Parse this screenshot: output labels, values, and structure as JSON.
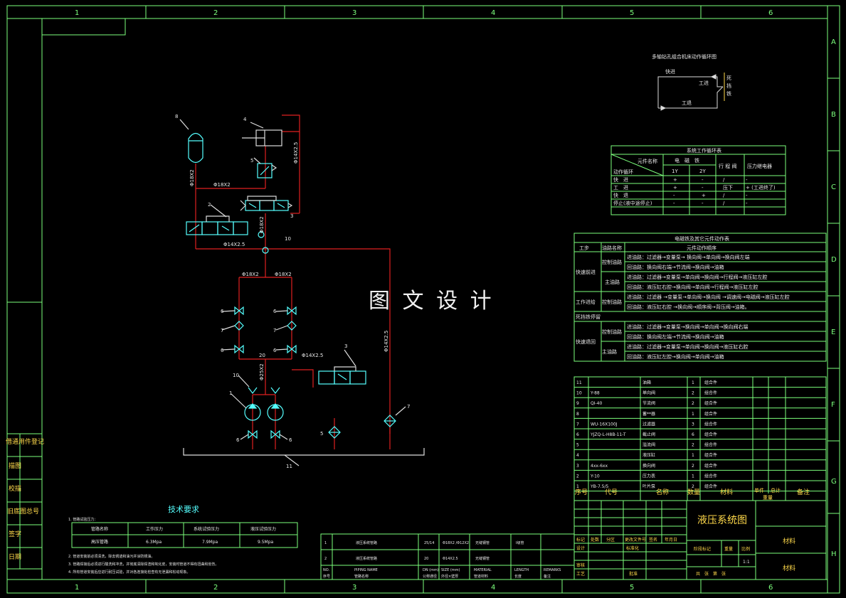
{
  "frame": {
    "top_cols": [
      "1",
      "2",
      "3",
      "4",
      "5",
      "6"
    ],
    "side_rows": [
      "A",
      "B",
      "C",
      "D",
      "E",
      "F",
      "G",
      "H"
    ],
    "left_labels": [
      "借通用件登记",
      "描图",
      "校描",
      "旧底图总号",
      "签字",
      "日期"
    ]
  },
  "watermark": "图 文 设 计",
  "cycle_diagram": {
    "title": "多轴钻孔组合机床动作循环图",
    "fast": "快进",
    "work": "工进",
    "stop": "死挡铁",
    "back": "工退"
  },
  "cycle_table": {
    "title": "系统工作循环表",
    "corner_top": "元件名称",
    "corner_bottom": "动作循环",
    "col_em": "电　磁　铁",
    "col_1y": "1Y",
    "col_2y": "2Y",
    "col_valve": "行 程 阀",
    "col_relay": "压力继电器",
    "rows": [
      {
        "act": "快　进",
        "y1": "+",
        "y2": "-",
        "valve": "/",
        "relay": "-"
      },
      {
        "act": "工　进",
        "y1": "+",
        "y2": "-",
        "valve": "压下",
        "relay": "+ (工进终了)"
      },
      {
        "act": "快　退",
        "y1": "-",
        "y2": "+",
        "valve": "/",
        "relay": "-"
      },
      {
        "act": "停止(液中途停止)",
        "y1": "-",
        "y2": "-",
        "valve": "/",
        "relay": "-"
      }
    ]
  },
  "action_table": {
    "title": "电磁铁及其它元件动作表",
    "h_step": "工步",
    "h_circuit": "油路名称",
    "h_action": "元件动作顺序",
    "g1": "快速前进",
    "g2": "工作进给",
    "g3": "死挡铁停留",
    "g4": "快速退回",
    "ctl": "控制油路",
    "main": "主油路",
    "l1": "进油路：过滤器→变量泵→ 换向阀→单向阀→换向阀左端",
    "l2": "回油路：换向阀右端→节流阀→换向阀→油箱",
    "l3": "进油路：过滤器→变量泵→单向阀→换向阀→行程阀→液压缸左腔",
    "l4": "回油路：液压缸右腔→换向阀→单向阀→行程阀→液压缸左腔",
    "l5": "进油路：过滤器 →变量泵→单向阀→换向阀 →调速阀→电磁阀→液压缸左腔",
    "l6": "回油路：液压缸右腔 →换向阀→顺序阀→背压阀→油箱。",
    "l7": "进油路：过滤器→变量泵→换向阀→单向阀→换向阀右端",
    "l8": "回油路：换向阀左端→节流阀→换向阀→油箱",
    "l9": "进油路：过滤器→变量泵→单向阀→换向阀→液压缸右腔",
    "l10": "回油路：液压缸左腔→换向阀→单向阀→油箱"
  },
  "parts": {
    "rows": [
      {
        "no": "11",
        "code": "",
        "name": "油箱",
        "qty": "1",
        "mat": "组合件"
      },
      {
        "no": "10",
        "code": "Y-88",
        "name": "单向阀",
        "qty": "2",
        "mat": "组合件"
      },
      {
        "no": "9",
        "code": "QI-40",
        "name": "节流阀",
        "qty": "2",
        "mat": "组合件"
      },
      {
        "no": "8",
        "code": "",
        "name": "蓄**器",
        "qty": "1",
        "mat": "组合件"
      },
      {
        "no": "7",
        "code": "WU-16X100J",
        "name": "过滤器",
        "qty": "3",
        "mat": "组合件"
      },
      {
        "no": "6",
        "code": "YJZQ-L-H8B-11-T",
        "name": "截止阀",
        "qty": "6",
        "mat": "组合件"
      },
      {
        "no": "5",
        "code": "",
        "name": "溢流阀",
        "qty": "2",
        "mat": "组合件"
      },
      {
        "no": "4",
        "code": "",
        "name": "液压缸",
        "qty": "1",
        "mat": "组合件"
      },
      {
        "no": "3",
        "code": "4xx-6xx",
        "name": "换向阀",
        "qty": "2",
        "mat": "组合件"
      },
      {
        "no": "2",
        "code": "Y-10",
        "name": "压力表",
        "qty": "1",
        "mat": "组合件"
      },
      {
        "no": "1",
        "code": "YB-7.5/5",
        "name": "叶片泵",
        "qty": "2",
        "mat": "组合件"
      }
    ],
    "h_no": "序号",
    "h_code": "代号",
    "h_name": "名称",
    "h_qty": "数量",
    "h_mat": "材料",
    "h_unit": "单件",
    "h_total": "总计",
    "h_weight": "重量",
    "h_note": "备注"
  },
  "title_block": {
    "title": "液压系统图",
    "material1": "材料",
    "material2": "材料",
    "mark": "标记",
    "count": "处数",
    "zone": "分区",
    "docno": "更改文件号",
    "sign": "签名",
    "date": "年月日",
    "design": "设计",
    "std": "标准化",
    "stage": "阶段标记",
    "weight": "重量",
    "scale": "比例",
    "scale_val": "1:1",
    "review": "审核",
    "craft": "工艺",
    "approve": "批准",
    "sheets": "共　张　第　张"
  },
  "tech": {
    "title": "技术要求",
    "item1": "1. 管路试验压力：",
    "th": [
      "管路名称",
      "工作压力",
      "系统试验压力",
      "液压试验压力"
    ],
    "tr": [
      "高压管路",
      "6.3Mpa",
      "7.9Mpa",
      "9.5Mpa"
    ],
    "item2": "2. 管道安装前必须清洗，除去锈迹和油污并涂防锈油。",
    "item3": "3. 管路焊接后必须进行酸洗和冲洗，并彻底清除焊渣和氧化皮，安装时管道不得有扭曲和划伤。",
    "item4": "4. 所有管道安装后应进行耐压试验，并对各连接处检查有无泄漏和松动现象。"
  },
  "pipe_table": {
    "r1": [
      "2",
      "液压系统管路",
      "20",
      "Φ14X2.5",
      "无缝钢管",
      ""
    ],
    "r2": [
      "1",
      "液压系统管路",
      "25/14",
      "Φ18X2 /Φ12X2",
      "无缝钢管",
      "Ⅰ级管"
    ],
    "h_en": [
      "NO.",
      "PIPING NAME",
      "DN (mm)",
      "SIZE (mm)",
      "MATERIAL",
      "LENGTH",
      "REMARKS"
    ],
    "h_cn": [
      "序号",
      "管路名称",
      "公称通径",
      "外径×壁厚",
      "管道材料",
      "长度",
      "备注"
    ]
  },
  "schematic": {
    "n1": "1",
    "n2": "2",
    "n3": "3",
    "n4": "4",
    "n5": "5",
    "n6": "6",
    "n7": "7",
    "n8": "8",
    "n9": "9",
    "n10": "10",
    "n11": "11",
    "p1": "Φ14X2.5",
    "p2": "Φ18X2",
    "p3": "Φ14X2.5",
    "p4": "Φ14X2.5",
    "p5": "Φ18X2",
    "p6": "Φ18X2",
    "p7": "Φ18X2",
    "p8": "Φ25X2",
    "p9": "Φ14X2.5",
    "p10": "Φ14X2.5",
    "p11": "Φ18X2",
    "p12": "Φ18X2",
    "p13": "20"
  }
}
